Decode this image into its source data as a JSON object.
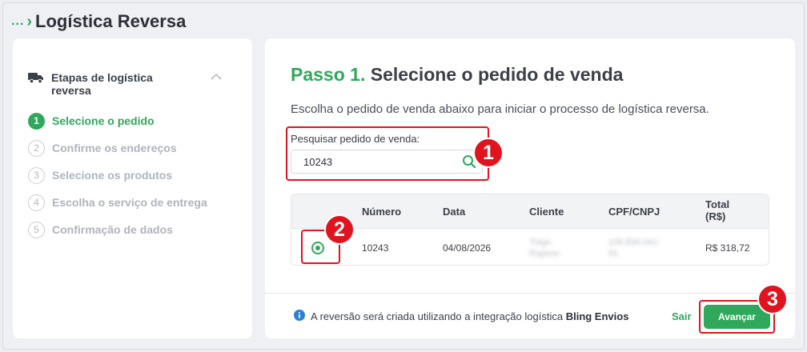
{
  "header": {
    "breadcrumb_ellipsis": "...",
    "title": "Logística Reversa"
  },
  "sidebar": {
    "section_title": "Etapas de logística reversa",
    "steps": [
      {
        "number": "1",
        "label": "Selecione o pedido",
        "state": "active"
      },
      {
        "number": "2",
        "label": "Confirme os endereços",
        "state": "pending"
      },
      {
        "number": "3",
        "label": "Selecione os produtos",
        "state": "pending"
      },
      {
        "number": "4",
        "label": "Escolha o serviço de entrega",
        "state": "pending"
      },
      {
        "number": "5",
        "label": "Confirmação de dados",
        "state": "pending"
      }
    ]
  },
  "main": {
    "step_prefix": "Passo 1.",
    "step_title": "Selecione o pedido de venda",
    "subtitle": "Escolha o pedido de venda abaixo para iniciar o processo de logística reversa.",
    "search": {
      "label": "Pesquisar pedido de venda:",
      "value": "10243"
    },
    "table": {
      "columns": [
        "Número",
        "Data",
        "Cliente",
        "CPF/CNPJ",
        "Total (R$)"
      ],
      "rows": [
        {
          "selected": true,
          "numero": "10243",
          "data": "04/08/2026",
          "cliente": "Tiago Raposo",
          "cpf_cnpj": "108.838.041-81",
          "total": "R$ 318,72"
        }
      ]
    },
    "footer": {
      "info_prefix": "A reversão será criada utilizando a integração logística",
      "info_integration": "Bling Envios",
      "exit_label": "Sair",
      "advance_label": "Avançar"
    }
  },
  "annotations": [
    "1",
    "2",
    "3"
  ],
  "colors": {
    "accent": "#2fa85b",
    "annotation": "#e0141e",
    "muted": "#b0b4bc"
  }
}
